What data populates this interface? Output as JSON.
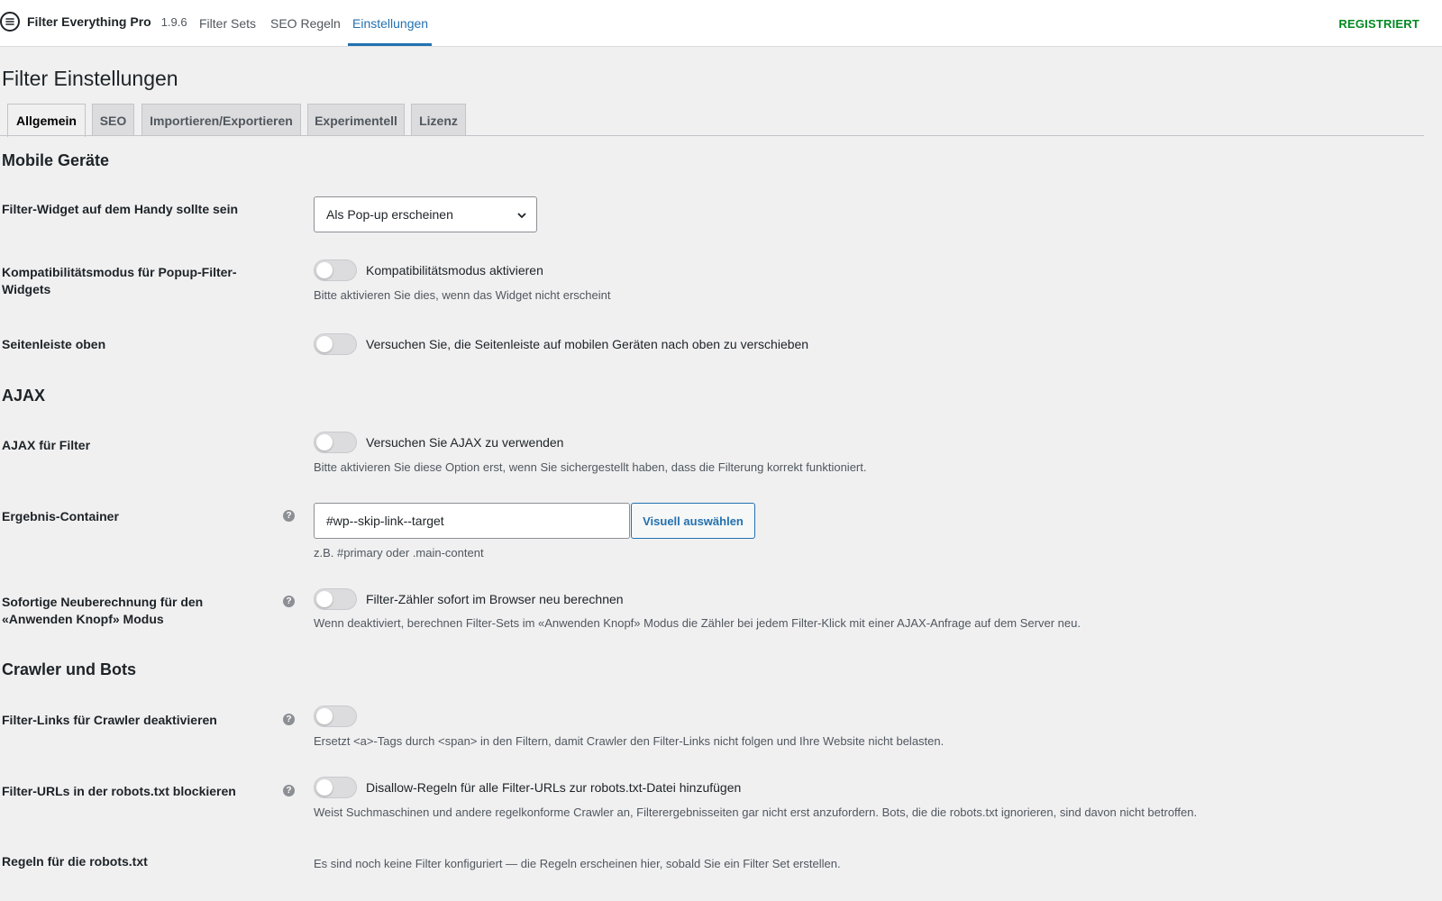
{
  "header": {
    "brand_name": "Filter Everything Pro",
    "version": "1.9.6",
    "nav": [
      {
        "label": "Filter Sets"
      },
      {
        "label": "SEO Regeln"
      },
      {
        "label": "Einstellungen",
        "active": true
      }
    ],
    "status": "REGISTRIERT",
    "status_color": "#008a20"
  },
  "page": {
    "title": "Filter Einstellungen"
  },
  "tabs": [
    {
      "label": "Allgemein",
      "active": true
    },
    {
      "label": "SEO"
    },
    {
      "label": "Importieren/Exportieren"
    },
    {
      "label": "Experimentell"
    },
    {
      "label": "Lizenz"
    }
  ],
  "sections": {
    "mobile": {
      "title": "Mobile Geräte",
      "widget": {
        "label": "Filter-Widget auf dem Handy sollte sein",
        "value": "Als Pop-up erscheinen"
      },
      "compat": {
        "label": "Kompatibilitätsmodus für Popup-Filter-Widgets",
        "toggle_label": "Kompatibilitätsmodus aktivieren",
        "enabled": false,
        "description": "Bitte aktivieren Sie dies, wenn das Widget nicht erscheint"
      },
      "sidebar_top": {
        "label": "Seitenleiste oben",
        "toggle_label": "Versuchen Sie, die Seitenleiste auf mobilen Geräten nach oben zu verschieben",
        "enabled": false
      }
    },
    "ajax": {
      "title": "AJAX",
      "ajax_filter": {
        "label": "AJAX für Filter",
        "toggle_label": "Versuchen Sie AJAX zu verwenden",
        "enabled": false,
        "description": "Bitte aktivieren Sie diese Option erst, wenn Sie sichergestellt haben, dass die Filterung korrekt funktioniert."
      },
      "container": {
        "label": "Ergebnis-Container",
        "value": "#wp--skip-link--target",
        "button": "Visuell auswählen",
        "description": "z.B. #primary oder .main-content"
      },
      "recalc": {
        "label": "Sofortige Neuberechnung für den «Anwenden Knopf» Modus",
        "toggle_label": "Filter-Zähler sofort im Browser neu berechnen",
        "enabled": false,
        "description": "Wenn deaktiviert, berechnen Filter-Sets im «Anwenden Knopf» Modus die Zähler bei jedem Filter-Klick mit einer AJAX-Anfrage auf dem Server neu."
      }
    },
    "crawlers": {
      "title": "Crawler und Bots",
      "disable_links": {
        "label": "Filter-Links für Crawler deaktivieren",
        "enabled": false,
        "description": "Ersetzt <a>-Tags durch <span> in den Filtern, damit Crawler den Filter-Links nicht folgen und Ihre Website nicht belasten."
      },
      "robots_block": {
        "label": "Filter-URLs in der robots.txt blockieren",
        "toggle_label": "Disallow-Regeln für alle Filter-URLs zur robots.txt-Datei hinzufügen",
        "enabled": false,
        "description": "Weist Suchmaschinen und andere regelkonforme Crawler an, Filterergebnisseiten gar nicht erst anzufordern. Bots, die die robots.txt ignorieren, sind davon nicht betroffen."
      },
      "robots_rules": {
        "label": "Regeln für die robots.txt",
        "description": "Es sind noch keine Filter konfiguriert — die Regeln erscheinen hier, sobald Sie ein Filter Set erstellen."
      }
    }
  },
  "help_glyph": "?",
  "icons": {
    "logo": "filter-logo-icon",
    "dropdown": "chevron-down-icon",
    "help": "help-icon"
  }
}
